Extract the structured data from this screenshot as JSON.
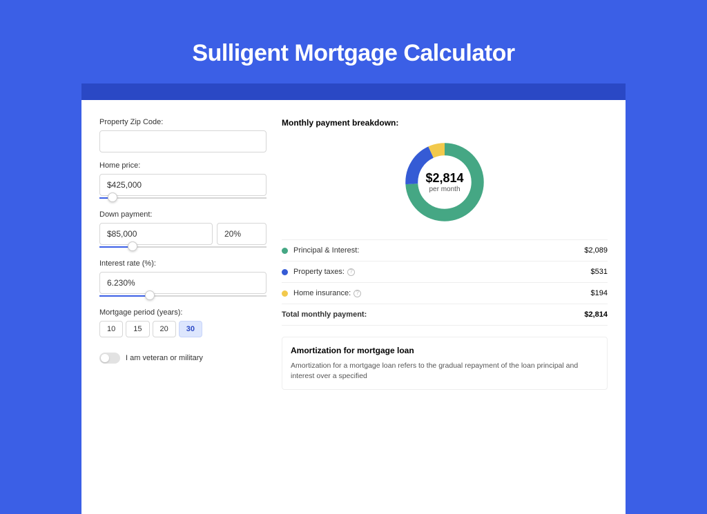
{
  "title": "Sulligent Mortgage Calculator",
  "form": {
    "zip": {
      "label": "Property Zip Code:",
      "value": ""
    },
    "home_price": {
      "label": "Home price:",
      "value": "$425,000",
      "slider_pct": 8
    },
    "down_payment": {
      "label": "Down payment:",
      "value": "$85,000",
      "pct_value": "20%",
      "slider_pct": 20
    },
    "interest_rate": {
      "label": "Interest rate (%):",
      "value": "6.230%",
      "slider_pct": 30
    },
    "period": {
      "label": "Mortgage period (years):",
      "options": [
        "10",
        "15",
        "20",
        "30"
      ],
      "selected": "30"
    },
    "veteran": {
      "label": "I am veteran or military",
      "on": false
    }
  },
  "breakdown": {
    "title": "Monthly payment breakdown:",
    "center_value": "$2,814",
    "center_sub": "per month",
    "items": [
      {
        "label": "Principal & Interest:",
        "value": "$2,089",
        "color": "#45A784",
        "pct": 74,
        "info": false
      },
      {
        "label": "Property taxes:",
        "value": "$531",
        "color": "#355BD5",
        "pct": 19,
        "info": true
      },
      {
        "label": "Home insurance:",
        "value": "$194",
        "color": "#F2C94C",
        "pct": 7,
        "info": true
      }
    ],
    "total": {
      "label": "Total monthly payment:",
      "value": "$2,814"
    }
  },
  "amortization": {
    "title": "Amortization for mortgage loan",
    "text": "Amortization for a mortgage loan refers to the gradual repayment of the loan principal and interest over a specified"
  },
  "chart_data": {
    "type": "pie",
    "title": "Monthly payment breakdown",
    "categories": [
      "Principal & Interest",
      "Property taxes",
      "Home insurance"
    ],
    "values": [
      2089,
      531,
      194
    ],
    "total": 2814,
    "unit": "USD per month"
  }
}
